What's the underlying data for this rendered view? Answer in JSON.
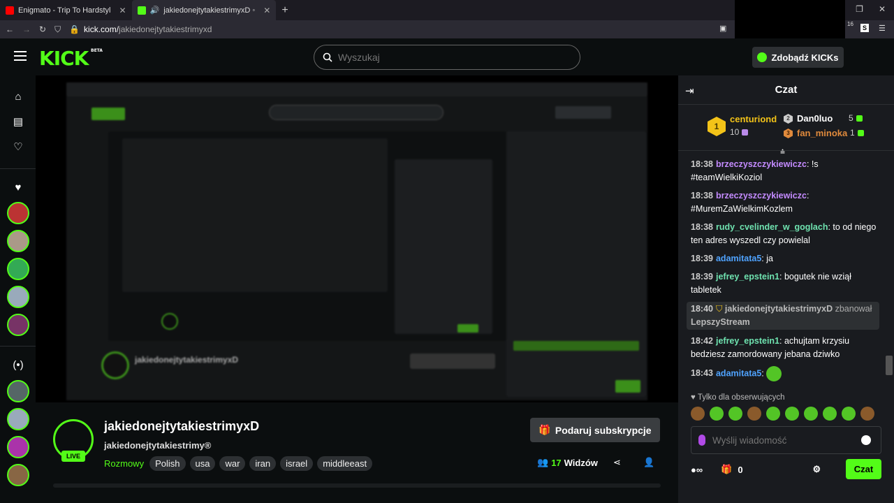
{
  "browser": {
    "tabs": [
      {
        "title": "Enigmato - Trip To Hardstyl",
        "favicon_color": "#ff0000"
      },
      {
        "title": "jakiedonejtytakiestrimyxD ◦",
        "favicon_color": "#53fc18"
      }
    ],
    "url_host": "kick.com/",
    "url_path": "jakiedonejtytakiestrimyxd",
    "badge_count": "16"
  },
  "header": {
    "logo": "KICK",
    "logo_sup": "BETA",
    "search_placeholder": "Wyszukaj",
    "get_kicks": "Zdobądź KICKs"
  },
  "stream": {
    "streamer": "jakiedonejtytakiestrimyxD",
    "title": "jakiedonejtytakiestrimy®",
    "live": "LIVE",
    "category": "Rozmowy",
    "tags": [
      "Polish",
      "usa",
      "war",
      "iran",
      "israel",
      "middleeast"
    ],
    "subscribe": "Podaruj subskrypcje",
    "viewers_count": "17",
    "viewers_label": "Widzów"
  },
  "chat": {
    "title": "Czat",
    "leaders": [
      {
        "rank": "1",
        "name": "centuriond",
        "count": "10",
        "color": "#f3c318"
      },
      {
        "rank": "2",
        "name": "Dan0luo",
        "count": "5",
        "color": "#d0d0d0"
      },
      {
        "rank": "3",
        "name": "fan_minoka",
        "count": "1",
        "color": "#e08a3c"
      }
    ],
    "messages": [
      {
        "time": "18:38",
        "user": "brzeczyszczykiewiczc",
        "color": "#c48bff",
        "text": "!s #teamWielkiKoziol"
      },
      {
        "time": "18:38",
        "user": "brzeczyszczykiewiczc",
        "color": "#c48bff",
        "text": "#MuremZaWielkimKozlem"
      },
      {
        "time": "18:38",
        "user": "rudy_cvelinder_w_goglach",
        "color": "#6fe3b0",
        "text": "to od niego ten adres wyszedl czy powielal"
      },
      {
        "time": "18:39",
        "user": "adamitata5",
        "color": "#4fa3ff",
        "text": "ja"
      },
      {
        "time": "18:39",
        "user": "jefrey_epstein1",
        "color": "#6fe3b0",
        "text": "bogutek nie wziął tabletek"
      },
      {
        "time": "18:42",
        "user": "jefrey_epstein1",
        "color": "#6fe3b0",
        "text": "achujtam krzysiu bedziesz zamordowany jebana dziwko"
      },
      {
        "time": "18:43",
        "user": "adamitata5",
        "color": "#4fa3ff",
        "text": ""
      }
    ],
    "mod_event": {
      "time": "18:40",
      "moderator": "jakiedonejtytakiestrimyxD",
      "action": "zbanował",
      "target": "LepszyStream"
    },
    "followers_only": "Tylko dla obserwujących",
    "input_placeholder": "Wyślij wiadomość",
    "kicks_count": "0",
    "send": "Czat",
    "accent": "#53fc18"
  }
}
